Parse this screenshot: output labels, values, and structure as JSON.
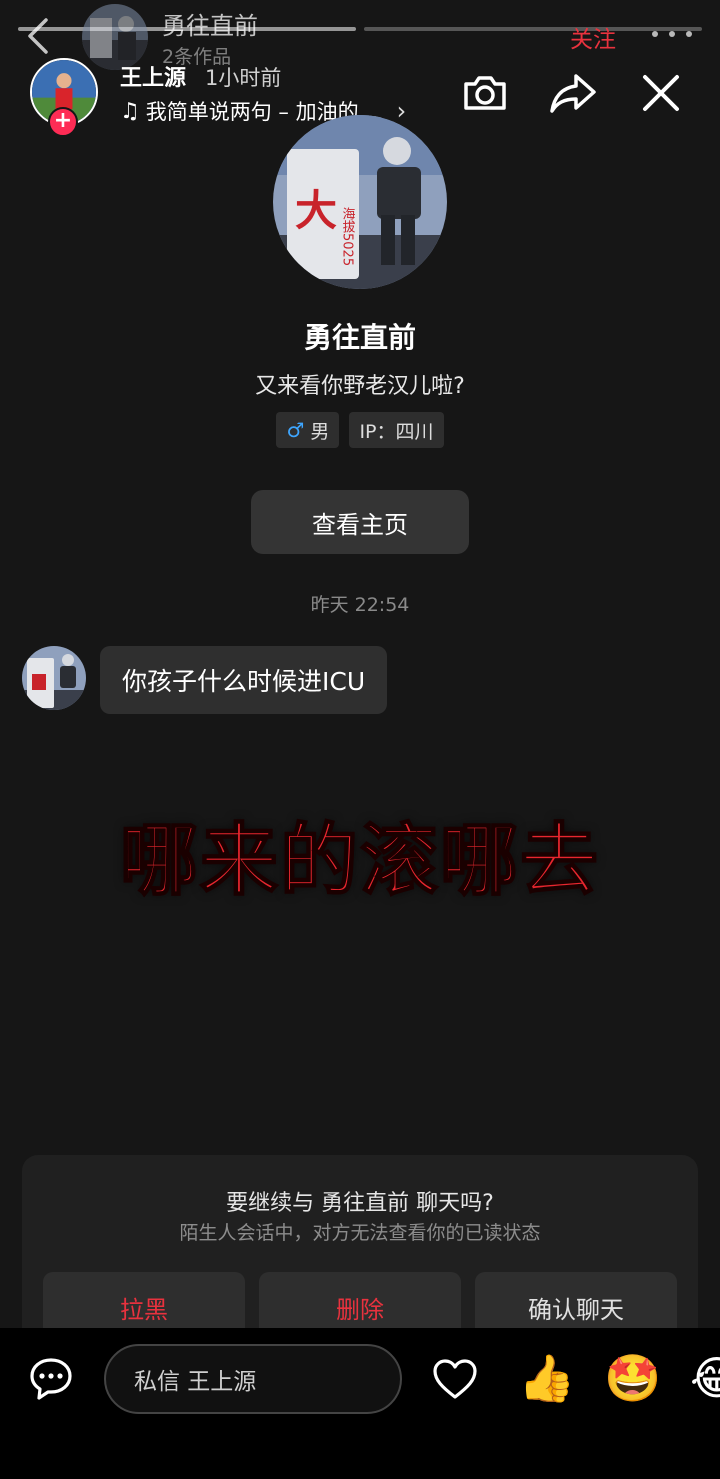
{
  "chat_header": {
    "name": "勇往直前",
    "sub": "2条作品",
    "follow_label": "关注"
  },
  "author": {
    "name": "王上源",
    "time": "1小时前",
    "music": "我简单说两句 – 加油的..."
  },
  "profile": {
    "name": "勇往直前",
    "bio": "又来看你野老汉儿啦?",
    "gender_symbol": "♂",
    "gender": "男",
    "ip": "IP：四川",
    "home_button": "查看主页",
    "avatar_text": "大",
    "avatar_text_2": "海拔5025"
  },
  "messages": {
    "timestamp": "昨天 22:54",
    "items": [
      {
        "text": "你孩子什么时候进ICU"
      }
    ]
  },
  "caption": "哪来的滚哪去",
  "prompt": {
    "title": "要继续与 勇往直前 聊天吗?",
    "subtitle": "陌生人会话中，对方无法查看你的已读状态",
    "block_label": "拉黑",
    "delete_label": "删除",
    "confirm_label": "确认聊天"
  },
  "bottom_bar": {
    "dm_placeholder": "私信 王上源",
    "emojis": [
      "👍",
      "🤩",
      "😂"
    ]
  },
  "colors": {
    "accent_red": "#e8323e",
    "caption_red": "#e8262e",
    "background": "#161616"
  }
}
